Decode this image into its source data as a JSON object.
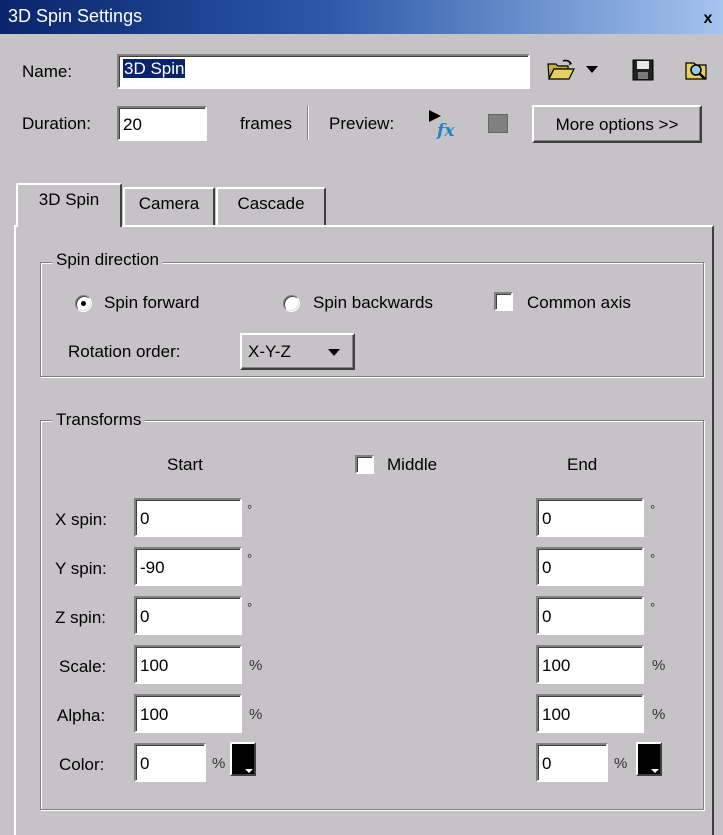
{
  "window": {
    "title": "3D Spin Settings",
    "close_glyph": "x"
  },
  "header": {
    "name_label": "Name:",
    "name_value": "3D Spin",
    "duration_label": "Duration:",
    "duration_value": "20",
    "duration_unit": "frames",
    "preview_label": "Preview:",
    "more_options_label": "More options >>",
    "icons": [
      "open-folder-icon",
      "dropdown-arrow-icon",
      "save-icon",
      "find-icon",
      "preview-fx-icon",
      "stop-icon"
    ]
  },
  "tabs": [
    {
      "label": "3D Spin",
      "active": true
    },
    {
      "label": "Camera",
      "active": false
    },
    {
      "label": "Cascade",
      "active": false
    }
  ],
  "spin_direction": {
    "legend": "Spin direction",
    "forward_label": "Spin forward",
    "forward_selected": true,
    "backwards_label": "Spin backwards",
    "backwards_selected": false,
    "common_axis_label": "Common axis",
    "common_axis_checked": false,
    "rotation_order_label": "Rotation order:",
    "rotation_order_value": "X-Y-Z"
  },
  "transforms": {
    "legend": "Transforms",
    "start_header": "Start",
    "middle_label": "Middle",
    "middle_checked": false,
    "end_header": "End",
    "degree_unit": "°",
    "percent_unit": "%",
    "rows": [
      {
        "label": "X spin:",
        "start": "0",
        "end": "0"
      },
      {
        "label": "Y spin:",
        "start": "-90",
        "end": "0"
      },
      {
        "label": "Z spin:",
        "start": "0",
        "end": "0"
      },
      {
        "label": "Scale:",
        "start": "100",
        "end": "100"
      },
      {
        "label": "Alpha:",
        "start": "100",
        "end": "100"
      },
      {
        "label": "Color:",
        "start": "0",
        "end": "0"
      }
    ],
    "color_start_swatch": "#000000",
    "color_end_swatch": "#000000"
  }
}
